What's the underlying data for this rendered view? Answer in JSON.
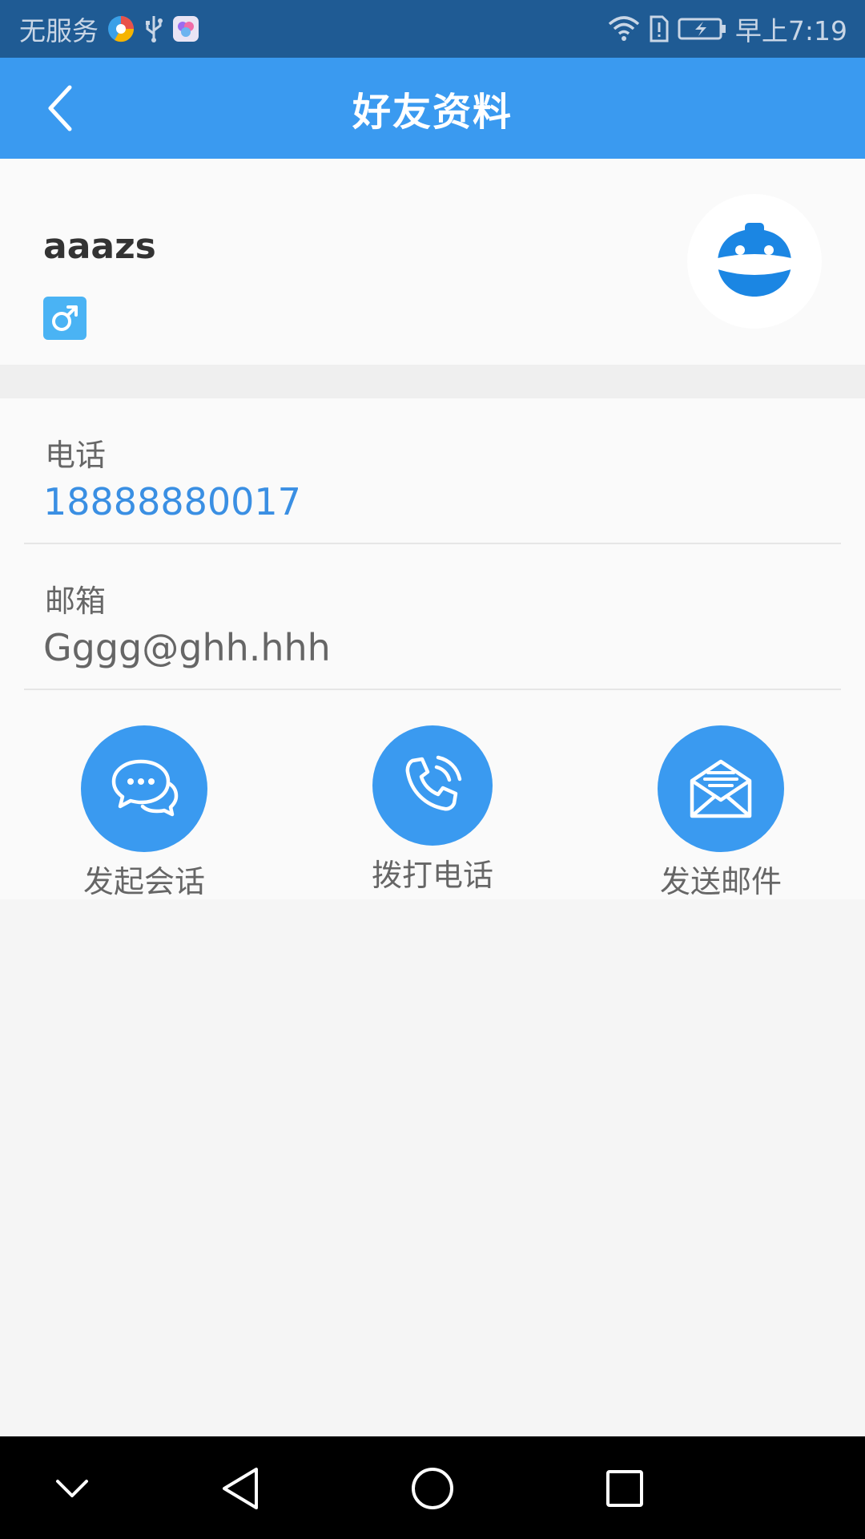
{
  "status_bar": {
    "carrier": "无服务",
    "time": "早上7:19",
    "icons": [
      "browser-icon",
      "usb-icon",
      "app-icon",
      "wifi-icon",
      "sim-alert-icon",
      "battery-charging-icon"
    ]
  },
  "header": {
    "title": "好友资料",
    "back_icon": "back-chevron-icon"
  },
  "profile": {
    "username": "aaazs",
    "gender_icon": "male-icon",
    "avatar_icon": "robot-avatar-icon"
  },
  "info": {
    "phone_label": "电话",
    "phone_value": "18888880017",
    "email_label": "邮箱",
    "email_value": "Gggg@ghh.hhh"
  },
  "actions": [
    {
      "label": "发起会话",
      "icon": "chat-bubbles-icon"
    },
    {
      "label": "拨打电话",
      "icon": "phone-call-icon"
    },
    {
      "label": "发送邮件",
      "icon": "mail-open-icon"
    }
  ],
  "nav_bar": {
    "icons": [
      "collapse-down-icon",
      "nav-back-icon",
      "nav-home-icon",
      "nav-recents-icon"
    ]
  },
  "colors": {
    "status_bar": "#1f5b94",
    "header": "#3a9af0",
    "accent_text": "#3a8fe3",
    "gender_badge": "#4ab3f4"
  }
}
